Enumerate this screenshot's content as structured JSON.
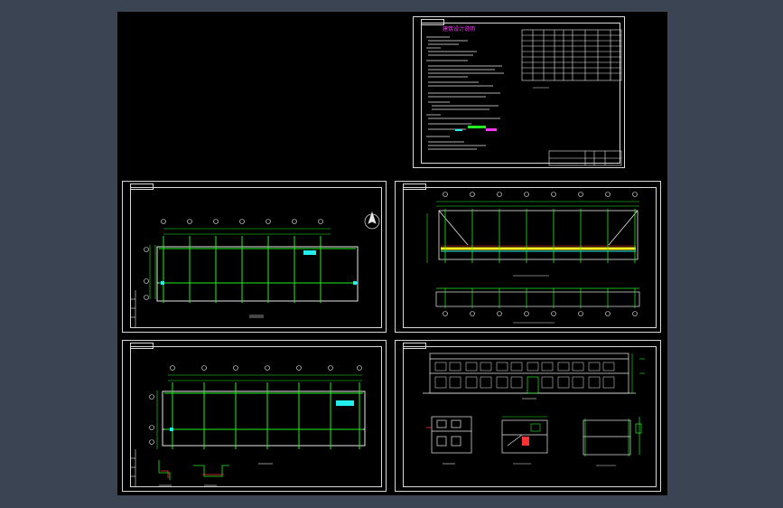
{
  "viewer": {
    "background_color": "#3b4452",
    "drawing_background": "#000000"
  },
  "sheets": {
    "notes": {
      "title": "建筑设计说明",
      "name": "design-notes-sheet"
    },
    "plan_1": {
      "name": "ground-floor-plan-sheet"
    },
    "roof": {
      "name": "roof-plan-sheet"
    },
    "plan_2": {
      "name": "second-floor-plan-sheet"
    },
    "elevations": {
      "name": "elevations-sections-sheet"
    }
  },
  "colors": {
    "line_white": "#e8e8e8",
    "line_green": "#22ee22",
    "line_cyan": "#22eeee",
    "line_yellow": "#ffee22",
    "line_magenta": "#ff33ff",
    "line_red": "#ff3333"
  }
}
